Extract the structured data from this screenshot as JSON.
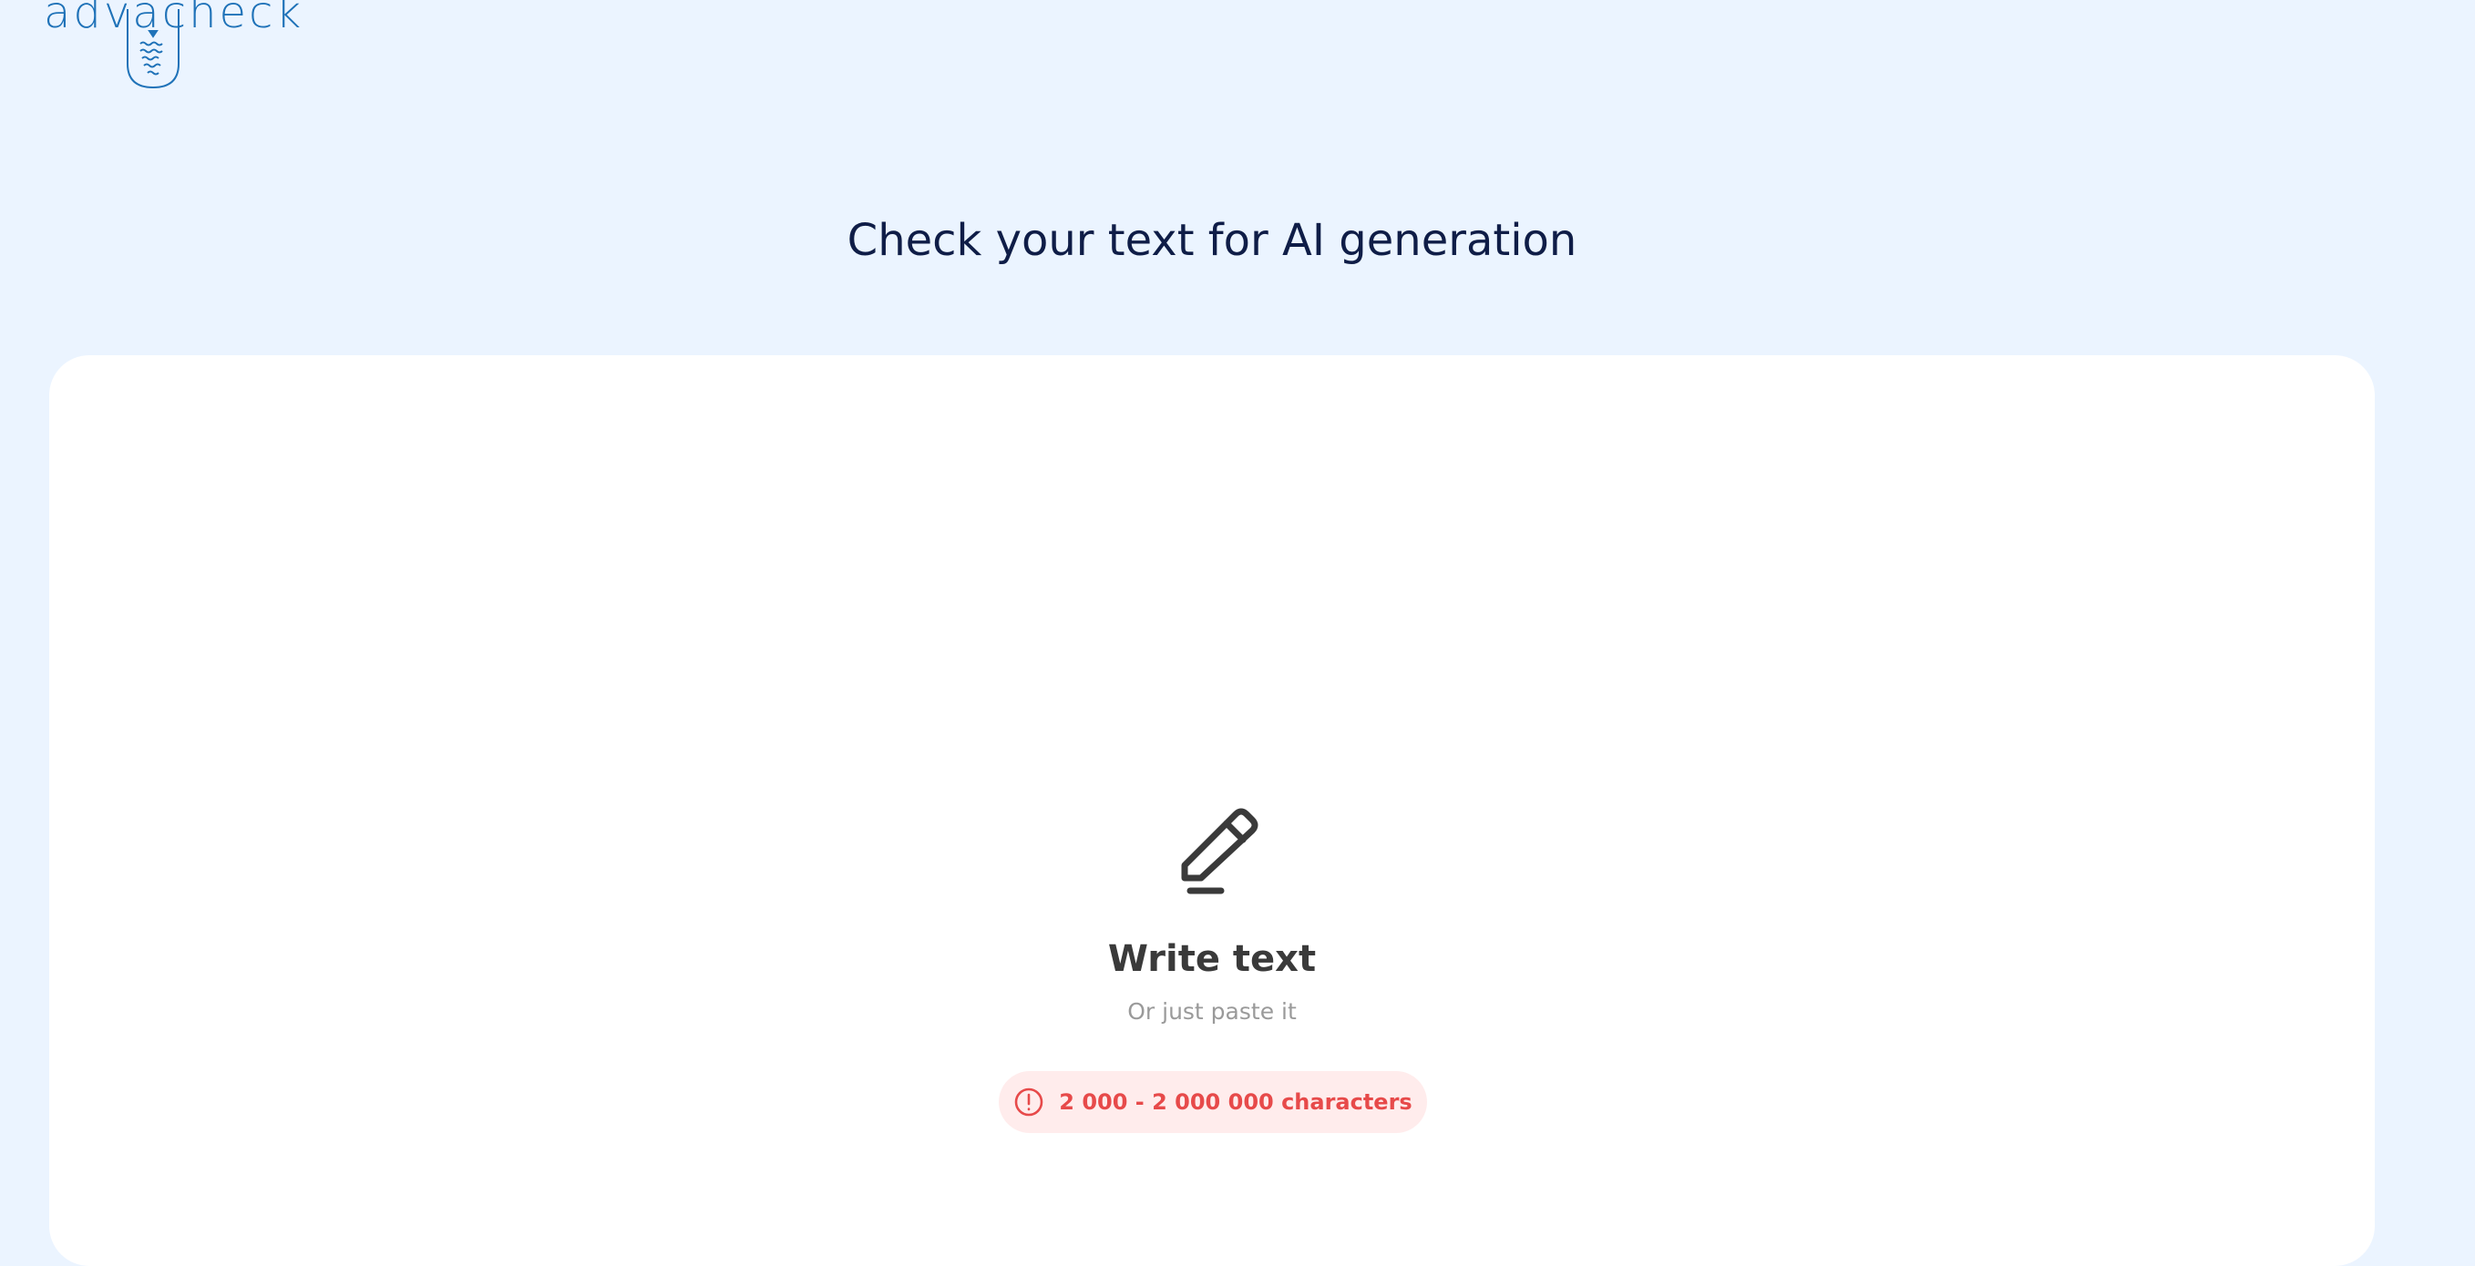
{
  "brand": {
    "logo_text": "advacheck",
    "color": "#1f72b8"
  },
  "header": {
    "title": "Check your text for AI generation"
  },
  "editor": {
    "icon": "pencil-icon",
    "title": "Write text",
    "hint": "Or just paste it",
    "limit": {
      "icon": "alert-circle-icon",
      "text": "2 000 - 2 000 000 characters",
      "color": "#e74a4a"
    }
  },
  "colors": {
    "background": "#ebf4ff",
    "card": "#ffffff",
    "title": "#0f1d47"
  }
}
